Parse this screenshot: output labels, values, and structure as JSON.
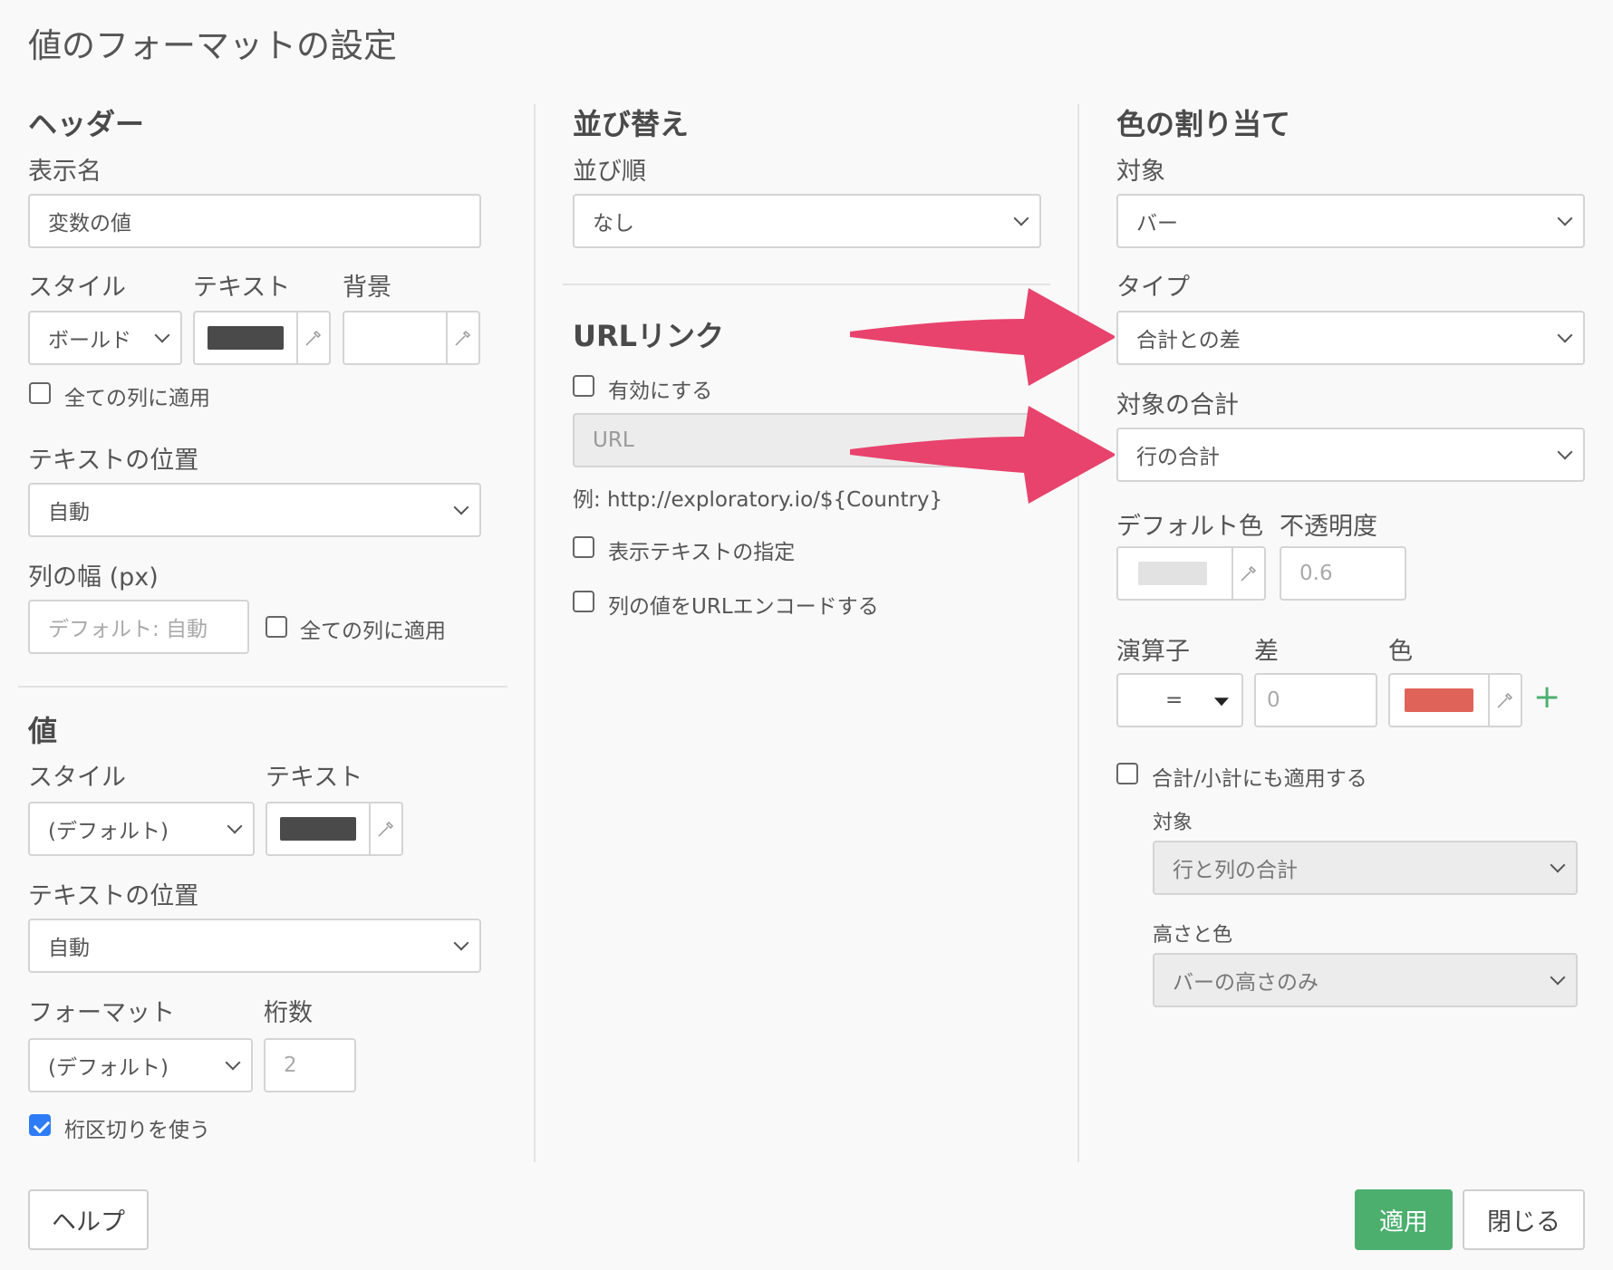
{
  "dialog": {
    "title": "値のフォーマットの設定"
  },
  "header_section": {
    "heading": "ヘッダー",
    "display_name_label": "表示名",
    "display_name_value": "変数の値",
    "style_label": "スタイル",
    "text_label": "テキスト",
    "background_label": "背景",
    "style_value": "ボールド",
    "text_color": "#4a4a4a",
    "apply_all_label": "全ての列に適用",
    "text_position_label": "テキストの位置",
    "text_position_value": "自動",
    "column_width_label": "列の幅 (px)",
    "column_width_placeholder": "デフォルト: 自動",
    "column_width_apply_all_label": "全ての列に適用"
  },
  "value_section": {
    "heading": "値",
    "style_label": "スタイル",
    "text_label": "テキスト",
    "style_value": "(デフォルト)",
    "text_color": "#4a4a4a",
    "text_position_label": "テキストの位置",
    "text_position_value": "自動",
    "format_label": "フォーマット",
    "digits_label": "桁数",
    "format_value": "(デフォルト)",
    "digits_placeholder": "2",
    "separator_label": "桁区切りを使う",
    "separator_checked": true
  },
  "sort_section": {
    "heading": "並び替え",
    "order_label": "並び順",
    "order_value": "なし"
  },
  "url_section": {
    "heading": "URLリンク",
    "enable_label": "有効にする",
    "url_placeholder": "URL",
    "example_text": "例: http://exploratory.io/${Country}",
    "display_text_label": "表示テキストの指定",
    "encode_label": "列の値をURLエンコードする"
  },
  "color_section": {
    "heading": "色の割り当て",
    "target_label": "対象",
    "target_value": "バー",
    "type_label": "タイプ",
    "type_value": "合計との差",
    "target_total_label": "対象の合計",
    "target_total_value": "行の合計",
    "default_color_label": "デフォルト色",
    "opacity_label": "不透明度",
    "default_color": "#e2e2e2",
    "opacity_placeholder": "0.6",
    "operator_label": "演算子",
    "diff_label": "差",
    "color_label": "色",
    "operator_value": "=",
    "diff_placeholder": "0",
    "rule_color": "#e0635a",
    "add_rule_icon": "plus-icon",
    "apply_totals_label": "合計/小計にも適用する",
    "sub_target_label": "対象",
    "sub_target_value": "行と列の合計",
    "height_color_label": "高さと色",
    "height_color_value": "バーの高さのみ"
  },
  "annotation": {
    "arrow_color": "#e8436c"
  },
  "footer": {
    "help_label": "ヘルプ",
    "apply_label": "適用",
    "close_label": "閉じる",
    "accent": "#4caf6e"
  }
}
